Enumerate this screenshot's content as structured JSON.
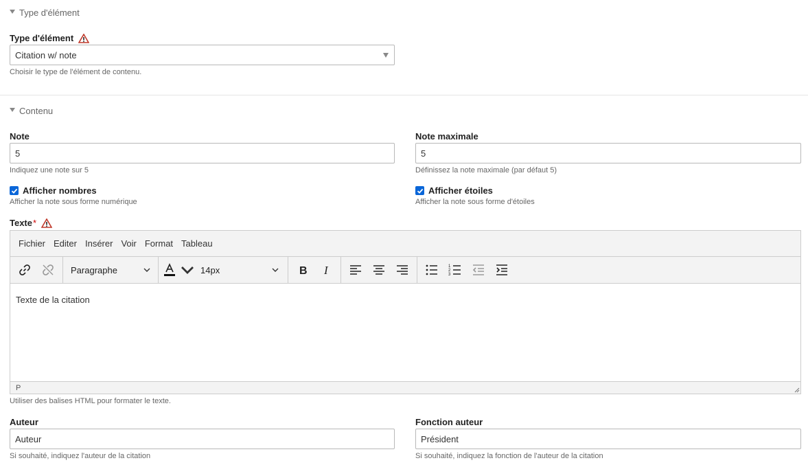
{
  "sections": {
    "type": "Type d'élément",
    "content": "Contenu"
  },
  "type_field": {
    "label": "Type d'élément",
    "value": "Citation w/ note",
    "help": "Choisir le type de l'élément de contenu."
  },
  "note": {
    "label": "Note",
    "value": "5",
    "help": "Indiquez une note sur 5"
  },
  "note_max": {
    "label": "Note maximale",
    "value": "5",
    "help": "Définissez la note maximale (par défaut 5)"
  },
  "show_numbers": {
    "label": "Afficher nombres",
    "help": "Afficher la note sous forme numérique",
    "checked": true
  },
  "show_stars": {
    "label": "Afficher étoiles",
    "help": "Afficher la note sous forme d'étoiles",
    "checked": true
  },
  "text": {
    "label": "Texte",
    "required_mark": "*",
    "help": "Utiliser des balises HTML pour formater le texte."
  },
  "editor": {
    "menu": [
      "Fichier",
      "Editer",
      "Insérer",
      "Voir",
      "Format",
      "Tableau"
    ],
    "block_format": "Paragraphe",
    "font_size": "14px",
    "content": "Texte de la citation",
    "status_path": "P"
  },
  "author": {
    "label": "Auteur",
    "value": "Auteur",
    "help": "Si souhaité, indiquez l'auteur de la citation"
  },
  "author_function": {
    "label": "Fonction auteur",
    "value": "Président",
    "help": "Si souhaité, indiquez la fonction de l'auteur de la citation"
  },
  "colors": {
    "accent": "#0a66d8",
    "warning": "#c0392b"
  }
}
